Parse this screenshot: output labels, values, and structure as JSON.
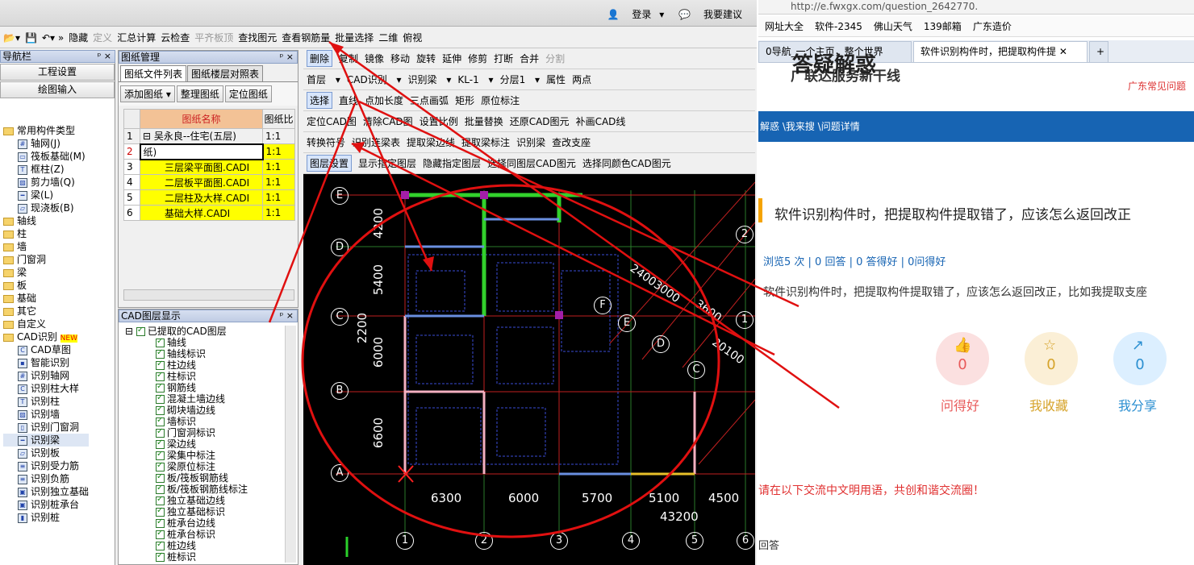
{
  "toolbar_top": {
    "login": "登录",
    "help": "我要建议"
  },
  "toolbar1": {
    "hide": "隐藏",
    "define": "定义",
    "sum": "汇总计算",
    "cloud": "云检查",
    "flat": "平齐板顶",
    "find": "查找图元",
    "view_rebar": "查看钢筋量",
    "batch": "批量选择",
    "view2d": "二维",
    "view_mode": "俯视"
  },
  "nav": {
    "title": "导航栏",
    "btn1": "工程设置",
    "btn2": "绘图输入",
    "group": "常用构件类型",
    "common": [
      {
        "label": "轴网(J)"
      },
      {
        "label": "筏板基础(M)"
      },
      {
        "label": "框柱(Z)"
      },
      {
        "label": "剪力墙(Q)"
      },
      {
        "label": "梁(L)"
      },
      {
        "label": "现浇板(B)"
      }
    ],
    "folders": [
      {
        "label": "轴线"
      },
      {
        "label": "柱"
      },
      {
        "label": "墙"
      },
      {
        "label": "门窗洞"
      },
      {
        "label": "梁"
      },
      {
        "label": "板"
      },
      {
        "label": "基础"
      },
      {
        "label": "其它"
      },
      {
        "label": "自定义"
      }
    ],
    "cad_folder": "CAD识别",
    "new_badge": "NEW",
    "cad": [
      {
        "label": "CAD草图"
      },
      {
        "label": "智能识别"
      },
      {
        "label": "识别轴网"
      },
      {
        "label": "识别柱大样"
      },
      {
        "label": "识别柱"
      },
      {
        "label": "识别墙"
      },
      {
        "label": "识别门窗洞"
      },
      {
        "label": "识别梁"
      },
      {
        "label": "识别板"
      },
      {
        "label": "识别受力筋"
      },
      {
        "label": "识别负筋"
      },
      {
        "label": "识别独立基础"
      },
      {
        "label": "识别桩承台"
      },
      {
        "label": "识别桩"
      }
    ]
  },
  "drawings": {
    "title": "图纸管理",
    "tab1": "图纸文件列表",
    "tab2": "图纸楼层对照表",
    "btn_add": "添加图纸",
    "btn_tidy": "整理图纸",
    "btn_locate": "定位图纸",
    "col_name": "图纸名称",
    "col_scale": "图纸比",
    "rows": [
      {
        "no": "1",
        "name": "吴永良--住宅(五层)",
        "scale": "1:1"
      },
      {
        "no": "2",
        "name": "纸)",
        "scale": "1:1"
      },
      {
        "no": "3",
        "name": "三层梁平面图.CADI",
        "scale": "1:1"
      },
      {
        "no": "4",
        "name": "二层板平面图.CADI",
        "scale": "1:1"
      },
      {
        "no": "5",
        "name": "二层柱及大样.CADI",
        "scale": "1:1"
      },
      {
        "no": "6",
        "name": "基础大样.CADI",
        "scale": "1:1"
      }
    ]
  },
  "layers": {
    "title": "CAD图层显示",
    "root": "已提取的CAD图层",
    "items": [
      {
        "label": "轴线"
      },
      {
        "label": "轴线标识"
      },
      {
        "label": "柱边线"
      },
      {
        "label": "柱标识"
      },
      {
        "label": "钢筋线"
      },
      {
        "label": "混凝土墙边线"
      },
      {
        "label": "砌块墙边线"
      },
      {
        "label": "墙标识"
      },
      {
        "label": "门窗洞标识"
      },
      {
        "label": "梁边线"
      },
      {
        "label": "梁集中标注"
      },
      {
        "label": "梁原位标注"
      },
      {
        "label": "板/筏板钢筋线"
      },
      {
        "label": "板/筏板钢筋线标注"
      },
      {
        "label": "独立基础边线"
      },
      {
        "label": "独立基础标识"
      },
      {
        "label": "桩承台边线"
      },
      {
        "label": "桩承台标识"
      },
      {
        "label": "桩边线"
      },
      {
        "label": "桩标识"
      }
    ]
  },
  "cadbar": {
    "r1": [
      "删除",
      "复制",
      "镜像",
      "移动",
      "旋转",
      "延伸",
      "修剪",
      "打断",
      "合并",
      "分割"
    ],
    "floor": "首层",
    "cadrec": "CAD识别",
    "rec_beam": "识别梁",
    "kl": "KL-1",
    "layer": "分层1",
    "prop": "属性",
    "two_pt": "两点",
    "r3": [
      "选择",
      "直线",
      "点加长度",
      "三点画弧",
      "矩形",
      "原位标注"
    ],
    "r4": [
      "定位CAD图",
      "清除CAD图",
      "设置比例",
      "批量替换",
      "还原CAD图元",
      "补画CAD线"
    ],
    "r5": [
      "转换符号",
      "识别连梁表",
      "提取梁边线",
      "提取梁标注",
      "识别梁",
      "查改支座"
    ],
    "r6": [
      "图层设置",
      "显示指定图层",
      "隐藏指定图层",
      "选择同图层CAD图元",
      "选择同颜色CAD图元"
    ]
  },
  "cad_drawing": {
    "axes_h": [
      "E",
      "D",
      "C",
      "B",
      "A"
    ],
    "axes_v": [
      "1",
      "2",
      "3",
      "4",
      "5",
      "6"
    ],
    "dims_left": [
      "4200",
      "5400",
      "2200",
      "6000",
      "6600"
    ],
    "dims_bottom": [
      "6300",
      "6000",
      "5700",
      "5100",
      "4500"
    ],
    "total": "43200",
    "diag_dims": [
      "2400",
      "3000",
      "3600",
      "20100"
    ],
    "diag_axes": [
      "F",
      "E",
      "D",
      "C",
      "2",
      "1"
    ]
  },
  "web": {
    "url": "http://e.fwxgx.com/question_2642770.",
    "fav": [
      "网址大全",
      "软件-2345",
      "佛山天气",
      "139邮箱",
      "广东造价"
    ],
    "tab1": "0导航_一个主页，整个世界",
    "tab2": "软件识别构件时，把提取构件提",
    "logo_big": "答疑解惑",
    "logo_sub": "广联达服务新干线",
    "right_link": "广东常见问题",
    "breadcrumb": "解惑 \\我来搜 \\问题详情",
    "title": "软件识别构件时，把提取构件提取错了，应该怎么返回改正",
    "stats": "浏览5 次 | 0 回答 | 0 答得好 | 0问得好",
    "body": "软件识别构件时，把提取构件提取错了，应该怎么返回改正，比如我提取支座",
    "actions": [
      {
        "label": "问得好",
        "count": "0",
        "color": "#e85a5a",
        "bg": "#fbe0e0"
      },
      {
        "label": "我收藏",
        "count": "0",
        "color": "#d6a32a",
        "bg": "#fbefd6"
      },
      {
        "label": "我分享",
        "count": "0",
        "color": "#2b8fd1",
        "bg": "#dcefff"
      }
    ],
    "rule": "请在以下交流中文明用语，共创和谐交流圈！",
    "answer": "回答"
  }
}
